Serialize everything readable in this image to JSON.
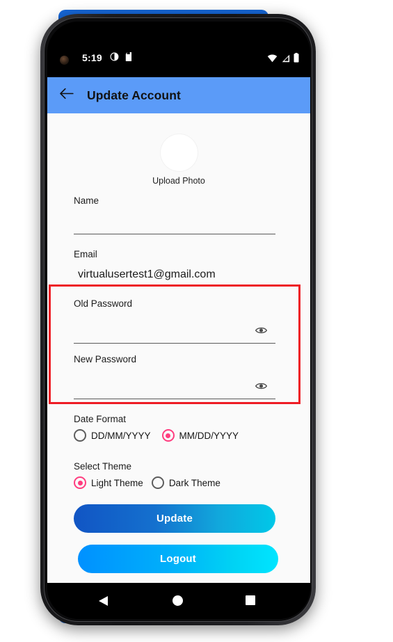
{
  "device": {
    "platform": "android-phone-mockup",
    "accent_strip_color": "#1667D8",
    "frame_color": "#1b1b1d"
  },
  "status_bar": {
    "time": "5:19",
    "left_icons": [
      "camera-punch-hole",
      "brightness-icon",
      "sdcard-icon"
    ],
    "right_icons": [
      "wifi-icon",
      "cellular-signal-icon",
      "battery-icon"
    ]
  },
  "app_bar": {
    "title": "Update Account",
    "back_icon": "arrow-left-icon",
    "background_color": "#5B9BF8",
    "text_color": "#121212"
  },
  "form": {
    "avatar": {
      "caption": "Upload Photo",
      "icon": "photo-placeholder-circle"
    },
    "fields": [
      {
        "label": "Name",
        "value": "",
        "type": "text"
      },
      {
        "label": "Email",
        "value": "virtualusertest1@gmail.com",
        "type": "email"
      },
      {
        "label": "Old Password",
        "value": "",
        "type": "password",
        "toggle_icon": "eye-icon"
      },
      {
        "label": "New Password",
        "value": "",
        "type": "password",
        "toggle_icon": "eye-icon"
      }
    ]
  },
  "highlight": {
    "color": "#EE1C25",
    "covers": [
      "Old Password",
      "New Password"
    ]
  },
  "date_format": {
    "title": "Date Format",
    "selected": "MM/DD/YYYY",
    "options": [
      {
        "label": "DD/MM/YYYY",
        "selected": false
      },
      {
        "label": "MM/DD/YYYY",
        "selected": true
      }
    ]
  },
  "theme": {
    "title": "Select Theme",
    "selected": "Light Theme",
    "options": [
      {
        "label": "Light Theme",
        "selected": true
      },
      {
        "label": "Dark Theme",
        "selected": false
      }
    ]
  },
  "radio_accent_color": "#FF3D7F",
  "actions": {
    "update_label": "Update",
    "logout_label": "Logout",
    "update_gradient": [
      "#1155C4",
      "#00C8E8"
    ],
    "logout_gradient": [
      "#0091FF",
      "#00E5FF"
    ]
  },
  "nav_bar": {
    "buttons": [
      "back-triangle-icon",
      "home-circle-icon",
      "recents-square-icon"
    ]
  }
}
